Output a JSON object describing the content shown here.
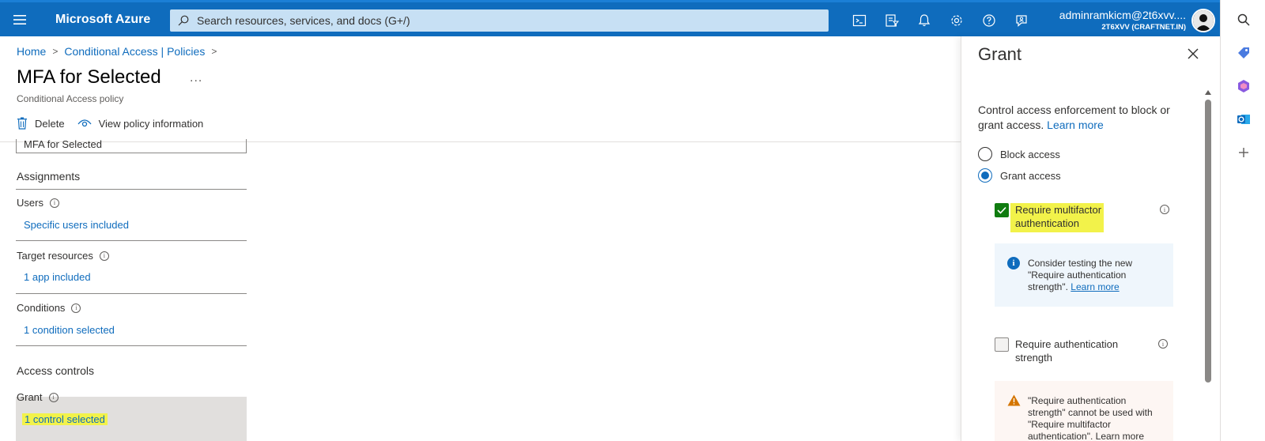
{
  "topbar": {
    "brand": "Microsoft Azure",
    "search_placeholder": "Search resources, services, and docs (G+/)",
    "account_name": "adminramkicm@2t6xvv....",
    "account_tenant": "2T6XVV (CRAFTNET.IN)",
    "icons": [
      "cloud-shell-icon",
      "directory-filter-icon",
      "notifications-icon",
      "settings-icon",
      "help-icon",
      "feedback-icon"
    ]
  },
  "breadcrumb": {
    "home": "Home",
    "section": "Conditional Access | Policies"
  },
  "page": {
    "title": "MFA for Selected",
    "more": "...",
    "subtitle": "Conditional Access policy",
    "toolbar": {
      "delete": "Delete",
      "view_info": "View policy information"
    },
    "name_value": "MFA for Selected"
  },
  "assignments": {
    "heading": "Assignments",
    "users_label": "Users",
    "users_link": "Specific users included",
    "target_label": "Target resources",
    "target_link": "1 app included",
    "conditions_label": "Conditions",
    "conditions_link": "1 condition selected"
  },
  "access_controls": {
    "heading": "Access controls",
    "grant_label": "Grant",
    "grant_link": "1 control selected"
  },
  "grant_panel": {
    "title": "Grant",
    "desc": "Control access enforcement to block or grant access.",
    "desc_link": "Learn more",
    "block_access": "Block access",
    "grant_access": "Grant access",
    "selected_option": "Grant access",
    "mfa_line1": "Require multifactor",
    "mfa_line2": "authentication",
    "mfa_checked": true,
    "info_text": "Consider testing the new \"Require authentication strength\".",
    "info_link": "Learn more",
    "auth_strength_line1": "Require authentication",
    "auth_strength_line2": "strength",
    "auth_strength_checked": false,
    "warn_text": "\"Require authentication strength\" cannot be used with \"Require multifactor authentication\". Learn more"
  },
  "colors": {
    "brand": "#0f6cbd",
    "highlight": "#f2f24a",
    "check": "#107c10",
    "warning": "#d47500"
  }
}
